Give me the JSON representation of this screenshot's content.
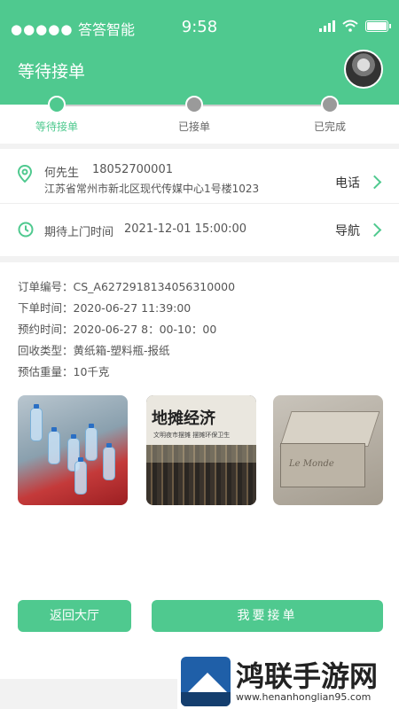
{
  "status_bar": {
    "signal": "●●●●●",
    "carrier": "答答智能",
    "time": "9:58"
  },
  "header": {
    "title": "等待接单",
    "avatar_icon": "user-avatar"
  },
  "steps": [
    {
      "label": "等待接单",
      "active": true
    },
    {
      "label": "已接单",
      "active": false
    },
    {
      "label": "已完成",
      "active": false
    }
  ],
  "contact": {
    "name": "何先生",
    "phone": "18052700001",
    "address": "江苏省常州市新北区现代传媒中心1号楼1023",
    "call_label": "电话",
    "eta_label": "期待上门时间",
    "eta_value": "2021-12-01   15:00:00",
    "nav_label": "导航"
  },
  "order": {
    "number": "订单编号：CS_A6272918134056310000",
    "created": "下单时间：2020-06-27  11:39:00",
    "appointment": "预约时间：2020-06-27  8：00-10：00",
    "type": "回收类型：黄纸箱-塑料瓶-报纸",
    "weight": "预估重量：10千克"
  },
  "photos": [
    {
      "name": "plastic-bottles-photo"
    },
    {
      "name": "newspaper-photo",
      "headline": "地摊经济",
      "subline": "文明夜市摆摊 摆摊环保卫生"
    },
    {
      "name": "cardboard-box-photo",
      "text": "Le Monde"
    }
  ],
  "actions": {
    "back": "返回大厅",
    "accept": "我要接单"
  },
  "watermark": {
    "text": "鸿联手游网",
    "url": "www.henanhonglian95.com"
  },
  "colors": {
    "accent": "#4fc98f",
    "inactive": "#9a9a9a"
  }
}
